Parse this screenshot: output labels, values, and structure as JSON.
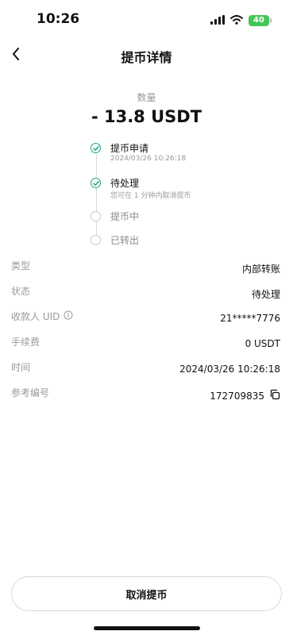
{
  "status_bar": {
    "time": "10:26",
    "battery": "40"
  },
  "nav": {
    "title": "提币详情"
  },
  "amount": {
    "label": "数量",
    "value": "- 13.8 USDT"
  },
  "timeline": [
    {
      "title": "提币申请",
      "sub": "2024/03/26 10:26:18",
      "state": "done"
    },
    {
      "title": "待处理",
      "sub": "您可在 1 分钟内取消提币",
      "state": "done"
    },
    {
      "title": "提币中",
      "sub": "",
      "state": "pending"
    },
    {
      "title": "已转出",
      "sub": "",
      "state": "pending"
    }
  ],
  "details": [
    {
      "label": "类型",
      "value": "内部转账"
    },
    {
      "label": "状态",
      "value": "待处理"
    },
    {
      "label": "收款人 UID",
      "value": "21*****7776"
    },
    {
      "label": "手续费",
      "value": "0 USDT"
    },
    {
      "label": "时间",
      "value": "2024/03/26 10:26:18"
    },
    {
      "label": "参考编号",
      "value": "172709835"
    }
  ],
  "actions": {
    "cancel_label": "取消提币"
  },
  "colors": {
    "accent": "#1da387",
    "muted": "#9a9a9a"
  }
}
